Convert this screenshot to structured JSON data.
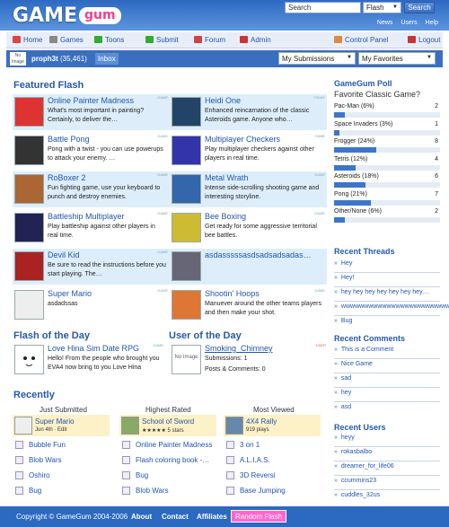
{
  "brand": {
    "logo_game": "GAME",
    "logo_gum": "gum"
  },
  "search": {
    "placeholder": "Search",
    "type": "Flash",
    "button": "Search"
  },
  "top_links": [
    "News",
    "Users",
    "Help"
  ],
  "nav": [
    {
      "label": "Home",
      "icon": "home-icon",
      "color": "#d44"
    },
    {
      "label": "Games",
      "icon": "gamepad-icon",
      "color": "#888"
    },
    {
      "label": "Toons",
      "icon": "film-icon",
      "color": "#3a3"
    },
    {
      "label": "Submit",
      "icon": "submit-icon",
      "color": "#3a3"
    },
    {
      "label": "Forum",
      "icon": "forum-icon",
      "color": "#c44"
    },
    {
      "label": "Admin",
      "icon": "admin-icon",
      "color": "#c33"
    },
    {
      "label": "Control Panel",
      "icon": "control-panel-icon",
      "color": "#d84"
    },
    {
      "label": "Logout",
      "icon": "logout-icon",
      "color": "#c33"
    }
  ],
  "user": {
    "avatar": "No Image",
    "name": "proph3t",
    "points": "(35,461)",
    "inbox": "Inbox",
    "submissions_select": "My Submissions",
    "favorites_select": "My Favorites"
  },
  "featured": {
    "title": "Featured Flash",
    "items": [
      {
        "title": "Online Painter Madness",
        "desc": "What's most important in painting? Certainly, to deliver the…",
        "tag": "GAME",
        "color": "#d33"
      },
      {
        "title": "Heidi One",
        "desc": "Enhanced reincarnation of the classic Asteroids game. Anyone who…",
        "tag": "TODAY",
        "color": "#246"
      },
      {
        "title": "Battle Pong",
        "desc": "Pong with a twist - you can use powerups to attack your enemy. …",
        "tag": "GAME",
        "color": "#333"
      },
      {
        "title": "Multiplayer Checkers",
        "desc": "Play multiplayer checkers against other players in real time.",
        "tag": "GAME",
        "color": "#33a"
      },
      {
        "title": "RoBoxer 2",
        "desc": "Fun fighting game, use your keyboard to punch and destroy enemies.",
        "tag": "GAME",
        "color": "#a63"
      },
      {
        "title": "Metal Wrath",
        "desc": "Intense side-scrolling shooting game and interesting storyline.",
        "tag": "GAME",
        "color": "#36a"
      },
      {
        "title": "Battleship Multiplayer",
        "desc": "Play battleship against other players in real time.",
        "tag": "GAME",
        "color": "#225"
      },
      {
        "title": "Bee Boxing",
        "desc": "Get ready for some aggressive territorial bee battles.",
        "tag": "GAME",
        "color": "#cb3"
      },
      {
        "title": "Devil Kid",
        "desc": "Be sure to read the instructions before you start playing. The…",
        "tag": "GAME",
        "color": "#a22"
      },
      {
        "title": "asdasssssasdsadsadsadas…",
        "desc": "",
        "tag": "",
        "color": "#667"
      },
      {
        "title": "Super Mario",
        "desc": "asdadssas",
        "tag": "GAME",
        "color": "#eee"
      },
      {
        "title": "Shootin' Hoops",
        "desc": "Manuever around the other teams players and then make your shot.",
        "tag": "GAME",
        "color": "#d73"
      }
    ]
  },
  "flash_of_day": {
    "title": "Flash of the Day",
    "item": "Love Hina Sim Date RPG",
    "desc": "Hello! From the people who brought you EVA4 now bring to you Love Hina",
    "tag": "GAME"
  },
  "user_of_day": {
    "title": "User of the Day",
    "avatar": "No Image",
    "name": "Smoking_Chimney",
    "submissions": "Submissions: 1",
    "posts": "Posts & Comments: 0",
    "tag": "USER"
  },
  "recent": {
    "title": "Recently",
    "columns": [
      {
        "head": "Just Submitted",
        "top": {
          "title": "Super Mario",
          "sub": "Jun 4th · Edit"
        },
        "rows": [
          "Bubble Fun",
          "Blob Wars",
          "Oshiro",
          "Bug"
        ]
      },
      {
        "head": "Highest Rated",
        "top": {
          "title": "School of Sword",
          "sub": "★★★★★ 5 stars"
        },
        "rows": [
          "Online Painter Madness",
          "Flash coloring book -…",
          "Bug",
          "Blob Wars"
        ]
      },
      {
        "head": "Most Viewed",
        "top": {
          "title": "4X4 Rally",
          "sub": "919 plays"
        },
        "rows": [
          "3 on 1",
          "A.L.I.A.S.",
          "3D Reversi",
          "Base Jumping"
        ]
      }
    ]
  },
  "poll": {
    "title": "GameGum Poll",
    "question": "Favorite Classic Game?",
    "options": [
      {
        "label": "Pac-Man (6%)",
        "count": "2",
        "pct": 6
      },
      {
        "label": "Space Invaders (3%)",
        "count": "1",
        "pct": 3
      },
      {
        "label": "Frogger (24%)",
        "count": "8",
        "pct": 24
      },
      {
        "label": "Tetris (12%)",
        "count": "4",
        "pct": 12
      },
      {
        "label": "Asteroids (18%)",
        "count": "6",
        "pct": 18
      },
      {
        "label": "Pong (21%)",
        "count": "7",
        "pct": 21
      },
      {
        "label": "Other/None (6%)",
        "count": "2",
        "pct": 6
      }
    ]
  },
  "recent_threads": {
    "title": "Recent Threads",
    "items": [
      "Hey",
      "Hey!",
      "hey hey hey hey hey hey hey…",
      "wwwwwwwwwwwwwwwwwwwwwwwww…",
      "Bug"
    ]
  },
  "recent_comments": {
    "title": "Recent Comments",
    "items": [
      "This is a Comment",
      "Nice Game",
      "sad",
      "hey",
      "asd"
    ]
  },
  "recent_users": {
    "title": "Recent Users",
    "items": [
      "heyy",
      "rokasbalbo",
      "dreamer_for_life06",
      "ccummins23",
      "cuddles_32us"
    ]
  },
  "footer": {
    "copyright": "Copyright © GameGum 2004-2006",
    "links": [
      "About",
      "Contact",
      "Affiliates"
    ],
    "random": "Random Flash"
  }
}
